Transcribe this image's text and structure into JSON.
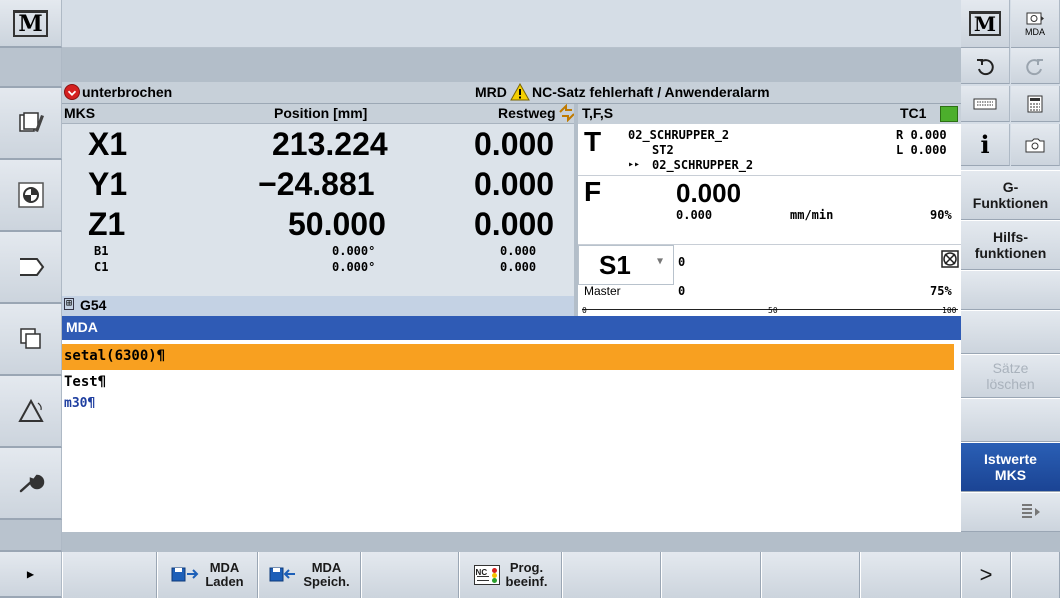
{
  "status": {
    "state": "unterbrochen",
    "channel": "MRD",
    "alarm": "NC-Satz fehlerhaft / Anwenderalarm"
  },
  "positions": {
    "headers": {
      "coord": "MKS",
      "position": "Position [mm]",
      "rest": "Restweg"
    },
    "axes": [
      {
        "name": "X1",
        "pos": "213.224",
        "rest": "0.000"
      },
      {
        "name": "Y1",
        "pos": "−24.881",
        "rest": "0.000"
      },
      {
        "name": "Z1",
        "pos": "50.000",
        "rest": "0.000"
      }
    ],
    "small_axes": [
      {
        "name": "B1",
        "pos": "0.000°",
        "rest": "0.000"
      },
      {
        "name": "C1",
        "pos": "0.000°",
        "rest": "0.000"
      }
    ],
    "frame": "G54"
  },
  "tfs": {
    "title": "T,F,S",
    "tc": "TC1",
    "t_label": "T",
    "tool": "02_SCHRUPPER_2",
    "tool_sub": "ST2",
    "next_arrow": "▸▸",
    "next_tool": "02_SCHRUPPER_2",
    "r": "R 0.000",
    "l": "L 0.000",
    "f_label": "F",
    "f_value": "0.000",
    "f_actual": "0.000",
    "f_unit": "mm/min",
    "f_override": "90%",
    "s_label": "S1",
    "s_value": "0",
    "s_master": "Master",
    "s_master_value": "0",
    "s_override": "75%",
    "scale": [
      "0",
      "50",
      "100"
    ]
  },
  "editor": {
    "title": "MDA",
    "lines": [
      "setal(6300)¶",
      "Test¶",
      "m30¶"
    ]
  },
  "right_softkeys": [
    {
      "label": "G-\nFunktionen",
      "state": "normal"
    },
    {
      "label": "Hilfs-\nfunktionen",
      "state": "normal"
    },
    {
      "label": "",
      "state": "normal"
    },
    {
      "label": "",
      "state": "normal"
    },
    {
      "label": "Sätze\nlöschen",
      "state": "disabled"
    },
    {
      "label": "",
      "state": "normal"
    },
    {
      "label": "Istwerte\nMKS",
      "state": "selected"
    },
    {
      "label": "",
      "state": "normal"
    }
  ],
  "right_top": {
    "m_label": "M",
    "mda_label": "MDA"
  },
  "bottom_softkeys": {
    "mda_laden": "MDA\nLaden",
    "mda_speich": "MDA\nSpeich.",
    "prog_beeinf": "Prog.\nbeeinf.",
    "nc_badge": "NC",
    "more": ">"
  },
  "left_top": {
    "m_label": "M"
  },
  "colors": {
    "header_blue": "#2f5bb5",
    "highlight_orange": "#f8a020",
    "alarm_red": "#d42020",
    "warning_yellow": "#f5d000",
    "selected_softkey": "#1f4fa3"
  }
}
